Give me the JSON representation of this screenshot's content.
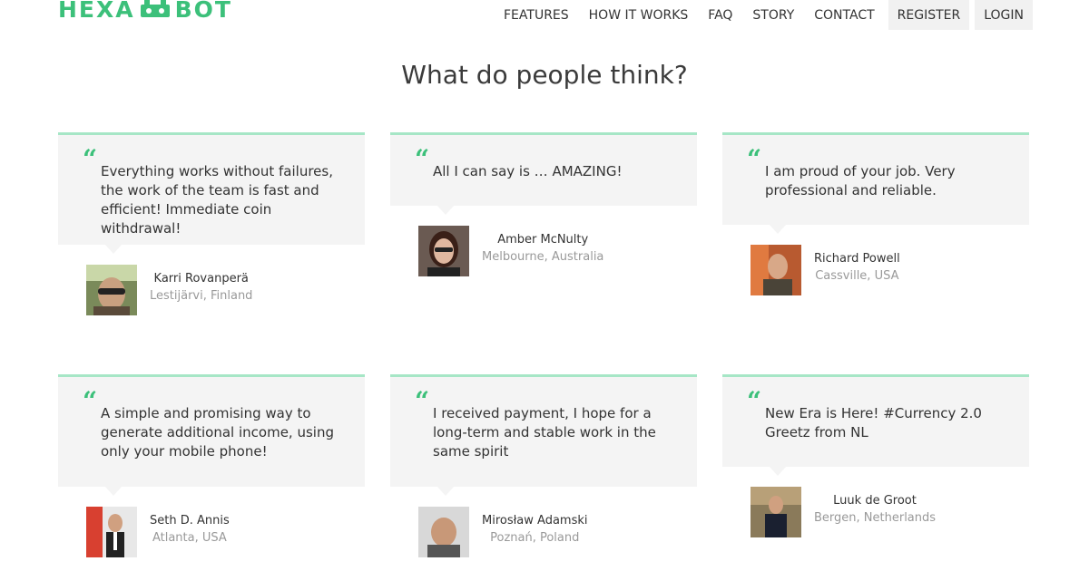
{
  "header": {
    "logo": {
      "left": "HEXA",
      "right": "BOT",
      "brand_color": "#3cc07a"
    },
    "nav": [
      {
        "label": "FEATURES",
        "name": "nav-features"
      },
      {
        "label": "HOW IT WORKS",
        "name": "nav-how-it-works"
      },
      {
        "label": "FAQ",
        "name": "nav-faq"
      },
      {
        "label": "STORY",
        "name": "nav-story"
      },
      {
        "label": "CONTACT",
        "name": "nav-contact"
      },
      {
        "label": "REGISTER",
        "name": "nav-register"
      },
      {
        "label": "LOGIN",
        "name": "nav-login"
      }
    ]
  },
  "main": {
    "title": "What do people think?",
    "accent_color": "#a6e6c6",
    "quote_icon": "quote-icon",
    "testimonials": [
      {
        "text": "Everything works without failures, the work of the team is fast and efficient! Immediate coin withdrawal!",
        "name": "Karri Rovanperä",
        "location": "Lestijärvi, Finland"
      },
      {
        "text": "All I can say is … AMAZING!",
        "name": "Amber McNulty",
        "location": "Melbourne, Australia"
      },
      {
        "text": "I am proud of your job. Very professional and reliable.",
        "name": "Richard Powell",
        "location": "Cassville, USA"
      },
      {
        "text": "A simple and promising way to generate additional income, using only your mobile phone!",
        "name": "Seth D. Annis",
        "location": "Atlanta, USA"
      },
      {
        "text": "I received payment, I hope for a long-term and stable work in the same spirit",
        "name": "Mirosław Adamski",
        "location": "Poznań, Poland"
      },
      {
        "text": "New Era is Here! #Currency 2.0 Greetz from NL",
        "name": "Luuk de Groot",
        "location": "Bergen, Netherlands"
      }
    ]
  }
}
